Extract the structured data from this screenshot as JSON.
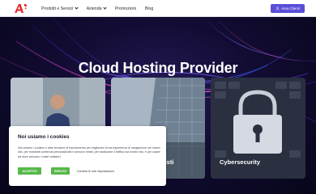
{
  "header": {
    "nav": [
      {
        "label": "Prodotti e Servizi",
        "dropdown": true
      },
      {
        "label": "Azienda",
        "dropdown": true
      },
      {
        "label": "Promozioni",
        "dropdown": false
      },
      {
        "label": "Blog",
        "dropdown": false
      }
    ],
    "cta_label": "Area Clienti"
  },
  "hero": {
    "title": "Cloud Hosting Provider"
  },
  "cards": [
    {
      "label": ""
    },
    {
      "label": "ssionisti"
    },
    {
      "label": "Cybersecurity"
    }
  ],
  "cookie": {
    "title": "Noi usiamo i cookies",
    "text": "Noi usiamo i cookies e altre tecniche di tracciamento per migliorare la tua esperienza di navigazione nel nostro sito, per mostrarti contenuti personalizzati e annunci mirati, per analizzare il traffico sul nostro sito, e per capire da dove arrivano i nostri visitatori.",
    "accept_label": "ACCETTO",
    "reject_label": "RIFIUTO",
    "settings_label": "Cambia le mie impostazioni"
  },
  "colors": {
    "accent": "#5a4fd6",
    "logo_red": "#e3262b",
    "cookie_button": "#56b848",
    "hero_bg": "#120c33"
  },
  "icons": [
    "logo",
    "chevron-down-icon",
    "user-icon",
    "lock-icon"
  ]
}
